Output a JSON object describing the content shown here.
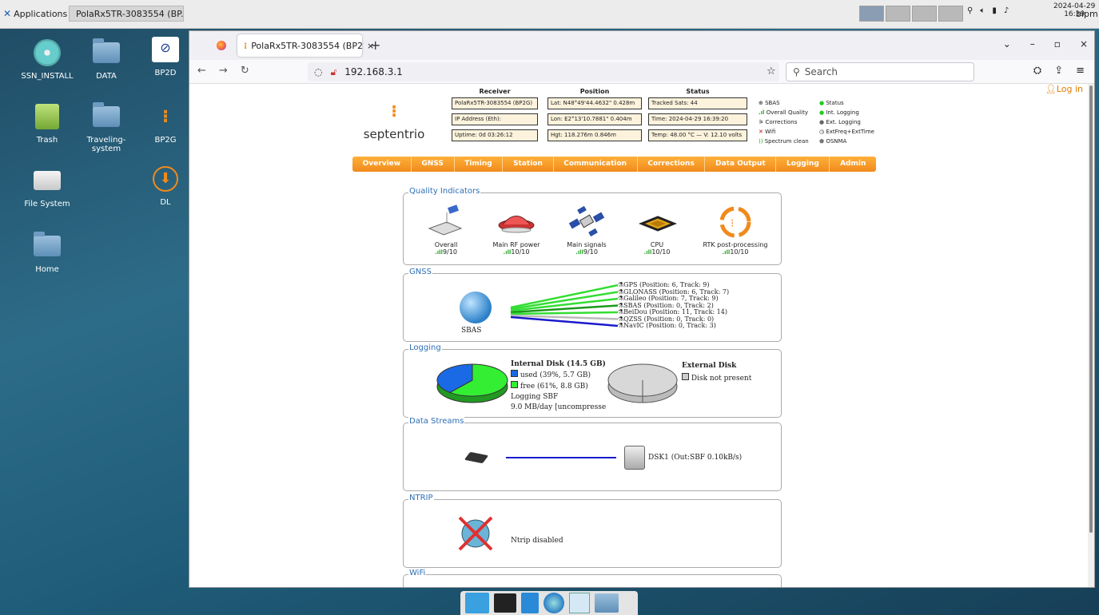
{
  "taskbar": {
    "apps_label": "Applications",
    "window_title": "PolaRx5TR-3083554 (BP..."
  },
  "tray": {
    "date": "2024-04-29",
    "time": "16:39",
    "user": "bipm"
  },
  "desktop": {
    "icons": [
      "SSN_INSTALL",
      "DATA",
      "BP2D",
      "Trash",
      "Traveling-system",
      "BP2G",
      "File System",
      "DL",
      "Home"
    ]
  },
  "browser": {
    "tab_title": "PolaRx5TR-3083554 (BP2",
    "url": "192.168.3.1",
    "search_placeholder": "Search"
  },
  "header": {
    "login": "Log in",
    "receiver_title": "Receiver",
    "receiver": [
      "PolaRx5TR-3083554 (BP2G)",
      "IP Address (Eth):",
      "Uptime: 0d 03:26:12"
    ],
    "position_title": "Position",
    "position": [
      "Lat:  N48°49'44.4632\"  0.428m",
      "Lon: E2°13'10.7881\"    0.404m",
      "Hgt:  118.276m             0.846m"
    ],
    "status_title": "Status",
    "status": [
      "Tracked Sats: 44",
      "Time: 2024-04-29 16:39:20",
      "Temp: 48.00 °C — V: 12.10 volts"
    ],
    "legend_left": [
      "SBAS",
      "Overall Quality",
      "Corrections",
      "Wifi",
      "Spectrum clean"
    ],
    "legend_right": [
      "Status",
      "Int. Logging",
      "Ext. Logging",
      "ExtFreq+ExtTime",
      "OSNMA"
    ]
  },
  "menu": [
    "Overview",
    "GNSS",
    "Timing",
    "Station",
    "Communication",
    "Corrections",
    "Data Output",
    "Logging",
    "Admin"
  ],
  "quality": {
    "legend": "Quality Indicators",
    "items": [
      {
        "label": "Overall",
        "score": "9/10"
      },
      {
        "label": "Main RF power",
        "score": "10/10"
      },
      {
        "label": "Main signals",
        "score": "9/10"
      },
      {
        "label": "CPU",
        "score": "10/10"
      },
      {
        "label": "RTK post-processing",
        "score": "10/10"
      }
    ]
  },
  "gnss": {
    "legend": "GNSS",
    "globe_label": "SBAS",
    "constellations": [
      "GPS (Position: 6, Track: 9)",
      "GLONASS (Position: 6, Track: 7)",
      "Galileo (Position: 7, Track: 9)",
      "SBAS (Position: 0, Track: 2)",
      "BeiDou (Position: 11, Track: 14)",
      "QZSS (Position: 0, Track: 0)",
      "NavIC (Position: 0, Track: 3)"
    ],
    "line_colors": [
      "#33dd33",
      "#33dd33",
      "#33dd33",
      "#1a9a1a",
      "#33dd33",
      "#bbbbbb",
      "#1a1acc"
    ]
  },
  "logging": {
    "legend": "Logging",
    "internal_title": "Internal Disk (14.5 GB)",
    "used": "used (39%, 5.7 GB)",
    "free": "free (61%, 8.8 GB)",
    "used_fraction": 0.39,
    "logging_line1": "Logging SBF",
    "logging_line2": "9.0 MB/day [uncompresse",
    "external_title": "External Disk",
    "external_status": "Disk not present"
  },
  "streams": {
    "legend": "Data Streams",
    "target": "DSK1 (Out:SBF 0.10kB/s)"
  },
  "ntrip": {
    "legend": "NTRIP",
    "status": "Ntrip disabled"
  },
  "wifi": {
    "legend": "WiFi"
  }
}
